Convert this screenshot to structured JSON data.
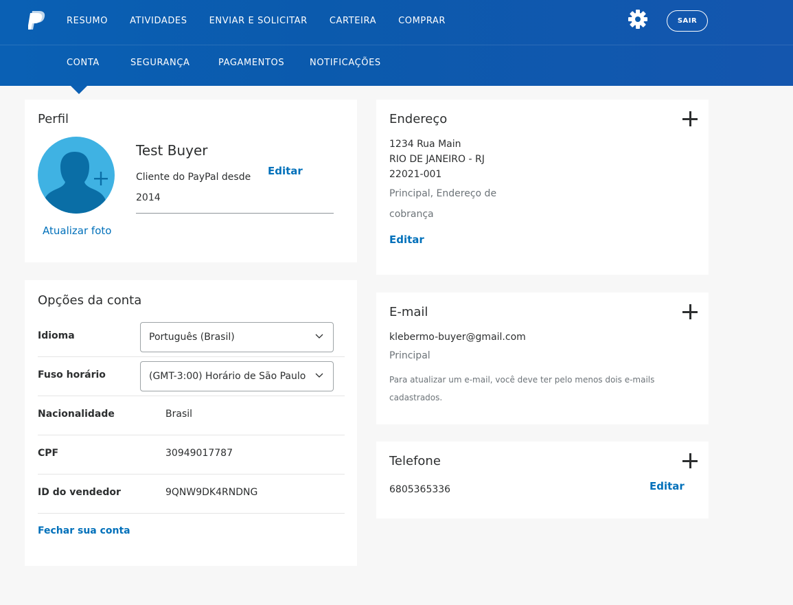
{
  "header": {
    "nav": [
      "RESUMO",
      "ATIVIDADES",
      "ENVIAR E SOLICITAR",
      "CARTEIRA",
      "COMPRAR"
    ],
    "logout_label": "SAIR",
    "subnav": [
      "CONTA",
      "SEGURANÇA",
      "PAGAMENTOS",
      "NOTIFICAÇÕES"
    ],
    "active_subnav": "CONTA"
  },
  "profile": {
    "title": "Perfil",
    "name": "Test Buyer",
    "member_since_line1": "Cliente do PayPal desde",
    "member_since_line2": "2014",
    "edit_label": "Editar",
    "update_photo_label": "Atualizar foto"
  },
  "account_options": {
    "title": "Opções da conta",
    "language_label": "Idioma",
    "language_value": "Português (Brasil)",
    "timezone_label": "Fuso horário",
    "timezone_value": "(GMT-3:00) Horário de São Paulo",
    "nationality_label": "Nacionalidade",
    "nationality_value": "Brasil",
    "cpf_label": "CPF",
    "cpf_value": "30949017787",
    "merchant_id_label": "ID do vendedor",
    "merchant_id_value": "9QNW9DK4RNDNG",
    "close_account_label": "Fechar sua conta"
  },
  "address": {
    "title": "Endereço",
    "line1": "1234 Rua Main",
    "line2": "RIO DE JANEIRO - RJ",
    "line3": "22021-001",
    "tag_line1": "Principal, Endereço de",
    "tag_line2": "cobrança",
    "edit_label": "Editar"
  },
  "email": {
    "title": "E-mail",
    "value": "klebermo-buyer@gmail.com",
    "tag": "Principal",
    "note_line1": "Para atualizar um e-mail, você deve ter pelo menos dois e-mails",
    "note_line2": "cadastrados."
  },
  "phone": {
    "title": "Telefone",
    "value": "6805365336",
    "edit_label": "Editar"
  },
  "colors": {
    "brand_blue": "#0b5fb3",
    "link_blue": "#0070ba",
    "avatar_light": "#3fb2e3",
    "avatar_dark": "#0a6ea6"
  }
}
